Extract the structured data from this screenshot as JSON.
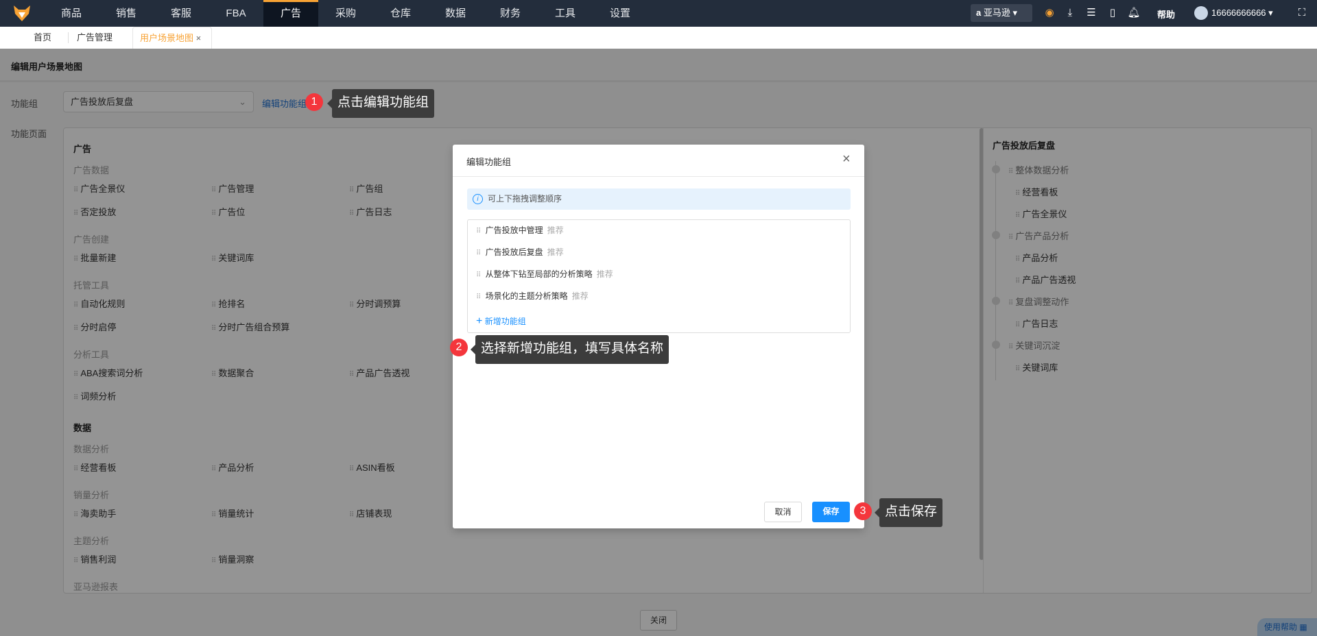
{
  "nav": {
    "items": [
      "商品",
      "销售",
      "客服",
      "FBA",
      "广告",
      "采购",
      "仓库",
      "数据",
      "财务",
      "工具",
      "设置"
    ],
    "active": 4,
    "store": "亚马逊",
    "help": "帮助",
    "user": "16666666666"
  },
  "tabs": [
    {
      "label": "首页"
    },
    {
      "label": "广告管理"
    },
    {
      "label": "用户场景地图"
    }
  ],
  "page": {
    "title": "编辑用户场景地图",
    "group_label": "功能组",
    "group_value": "广告投放后复盘",
    "edit_link": "编辑功能组",
    "pages_label": "功能页面",
    "close": "关闭",
    "help_float": "使用帮助"
  },
  "left": [
    {
      "title": "广告",
      "subs": [
        {
          "name": "广告数据",
          "items": [
            "广告全景仪",
            "广告管理",
            "广告组",
            "否定投放",
            "广告位",
            "广告日志"
          ]
        },
        {
          "name": "广告创建",
          "items": [
            "批量新建",
            "关键词库"
          ]
        },
        {
          "name": "托管工具",
          "items": [
            "自动化规则",
            "抢排名",
            "分时调预算",
            "分时启停",
            "分时广告组合预算"
          ]
        },
        {
          "name": "分析工具",
          "items": [
            "ABA搜索词分析",
            "数据聚合",
            "产品广告透视",
            "词频分析"
          ]
        }
      ]
    },
    {
      "title": "数据",
      "subs": [
        {
          "name": "数据分析",
          "items": [
            "经营看板",
            "产品分析",
            "ASIN看板"
          ]
        },
        {
          "name": "销量分析",
          "items": [
            "海卖助手",
            "销量统计",
            "店铺表现"
          ]
        },
        {
          "name": "主题分析",
          "items": [
            "销售利润",
            "销量洞察"
          ]
        },
        {
          "name": "亚马逊报表",
          "items": []
        }
      ]
    }
  ],
  "right": {
    "title": "广告投放后复盘",
    "groups": [
      {
        "name": "整体数据分析",
        "items": [
          "经营看板",
          "广告全景仪"
        ]
      },
      {
        "name": "广告产品分析",
        "items": [
          "产品分析",
          "产品广告透视"
        ]
      },
      {
        "name": "复盘调整动作",
        "items": [
          "广告日志"
        ]
      },
      {
        "name": "关键词沉淀",
        "items": [
          "关键词库"
        ]
      }
    ]
  },
  "modal": {
    "title": "编辑功能组",
    "hint": "可上下拖拽调整顺序",
    "groups": [
      {
        "name": "广告投放中管理",
        "tag": "推荐"
      },
      {
        "name": "广告投放后复盘",
        "tag": "推荐"
      },
      {
        "name": "从整体下钻至局部的分析策略",
        "tag": "推荐"
      },
      {
        "name": "场景化的主题分析策略",
        "tag": "推荐"
      }
    ],
    "add": "新增功能组",
    "cancel": "取消",
    "save": "保存"
  },
  "guides": [
    {
      "n": "1",
      "text": "点击编辑功能组"
    },
    {
      "n": "2",
      "text": "选择新增功能组，填写具体名称"
    },
    {
      "n": "3",
      "text": "点击保存"
    }
  ],
  "colors": {
    "accent": "#f7a234",
    "primary": "#1890ff",
    "badge": "#f4363c"
  }
}
